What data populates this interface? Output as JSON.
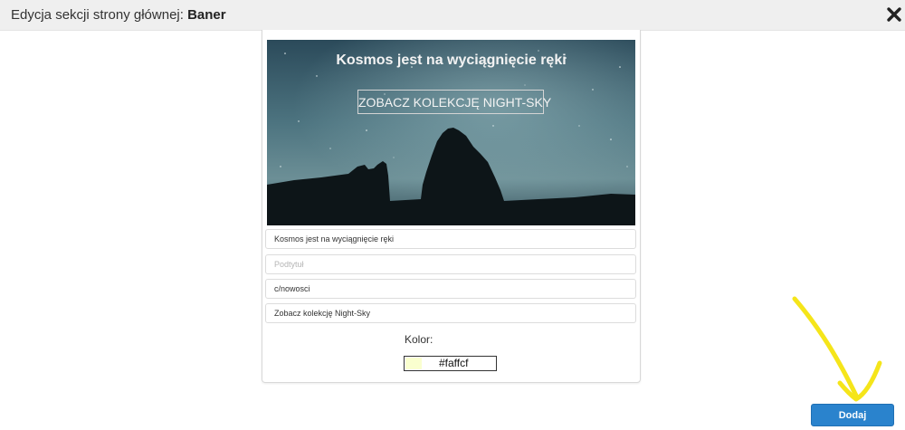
{
  "header": {
    "title_prefix": "Edycja sekcji strony głównej: ",
    "title_bold": "Baner"
  },
  "icons": {
    "close": "close-icon"
  },
  "banner": {
    "heading": "Kosmos jest na wyciągnięcie ręki",
    "button_label": "ZOBACZ KOLEKCJĘ NIGHT-SKY"
  },
  "form": {
    "title_value": "Kosmos jest na wyciągnięcie ręki",
    "subtitle_placeholder": "Podtytuł",
    "subtitle_value": "",
    "link_value": "c/nowosci",
    "button_text_value": "Zobacz kolekcję Night-Sky",
    "color_label": "Kolor:",
    "color_value": "#faffcf",
    "swatch_color": "#faffcf"
  },
  "footer": {
    "submit_label": "Dodaj"
  },
  "colors": {
    "accent": "#2a83cd",
    "annotation": "#f5e51a"
  }
}
